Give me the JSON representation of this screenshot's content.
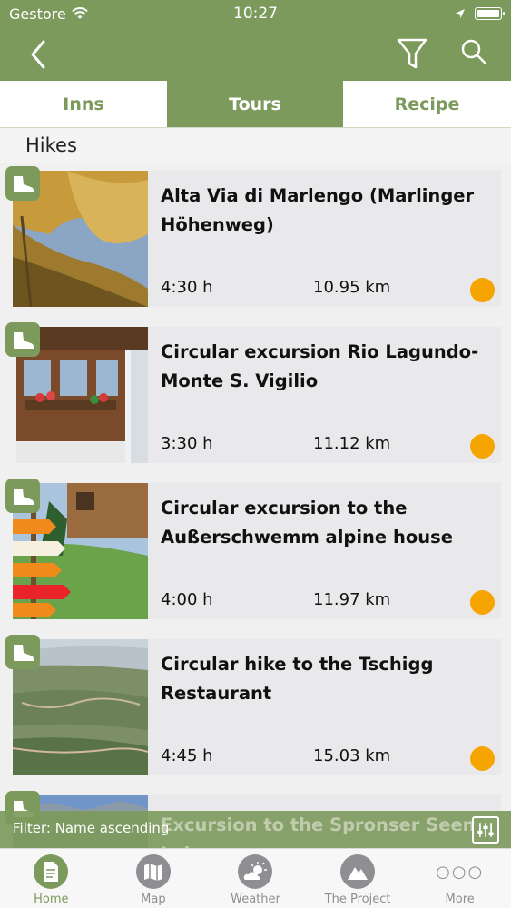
{
  "status": {
    "carrier": "Gestore",
    "time": "10:27"
  },
  "tabs": [
    {
      "label": "Inns"
    },
    {
      "label": "Tours"
    },
    {
      "label": "Recipe"
    }
  ],
  "section": {
    "title": "Hikes"
  },
  "tours": [
    {
      "title": "Alta Via di Marlengo (Marlinger Höhenweg)",
      "duration": "4:30 h",
      "distance": "10.95 km"
    },
    {
      "title": "Circular excursion Rio Lagundo-Monte S. Vigilio",
      "duration": "3:30 h",
      "distance": "11.12 km"
    },
    {
      "title": "Circular excursion to the Außerschwemm alpine house",
      "duration": "4:00 h",
      "distance": "11.97 km"
    },
    {
      "title": "Circular hike to the Tschigg Restaurant",
      "duration": "4:45 h",
      "distance": "15.03 km"
    },
    {
      "title": "Excursion to the Spronser Seen Lakes"
    }
  ],
  "filter": {
    "text": "Filter: Name ascending"
  },
  "tabbar": [
    {
      "label": "Home"
    },
    {
      "label": "Map"
    },
    {
      "label": "Weather"
    },
    {
      "label": "The Project"
    },
    {
      "label": "More"
    }
  ],
  "colors": {
    "brand": "#7d9a5d",
    "difficulty_dot": "#f5a400"
  }
}
